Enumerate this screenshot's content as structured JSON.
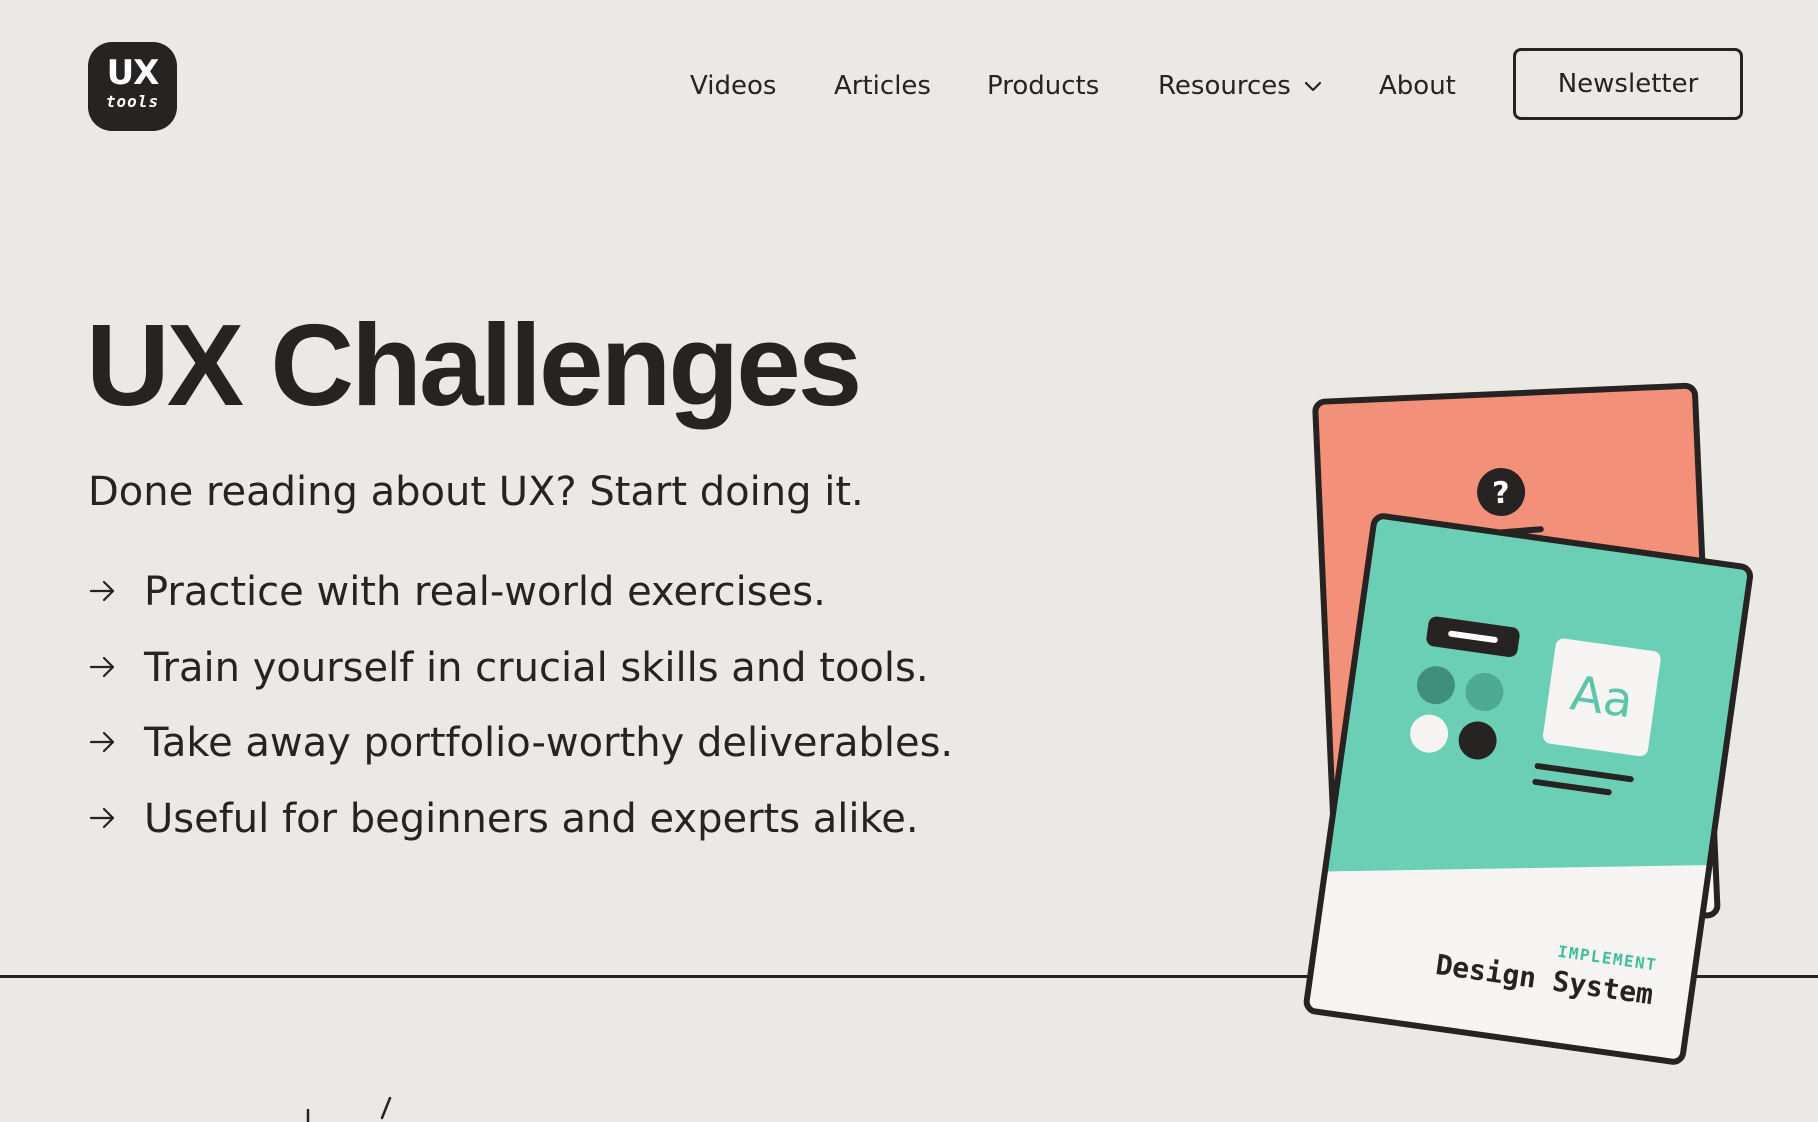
{
  "logo": {
    "ux": "UX",
    "tools": "tools"
  },
  "nav": {
    "videos": "Videos",
    "articles": "Articles",
    "products": "Products",
    "resources": "Resources",
    "about": "About",
    "newsletter": "Newsletter"
  },
  "hero": {
    "title": "UX Challenges",
    "subtitle": "Done reading about UX? Start doing it.",
    "features": [
      "Practice with real-world exercises.",
      "Train yourself in crucial skills and tools.",
      "Take away portfolio-worthy deliverables.",
      "Useful for beginners and experts alike."
    ]
  },
  "cards": {
    "front": {
      "category": "IMPLEMENT",
      "title": "Design System",
      "typography_sample": "Aa"
    },
    "back": {
      "badge": "?"
    }
  },
  "colors": {
    "background": "#ebe9e6",
    "ink": "#262322",
    "coral": "#f3907a",
    "teal": "#6bcfb6",
    "card_white": "#f6f5f3"
  }
}
